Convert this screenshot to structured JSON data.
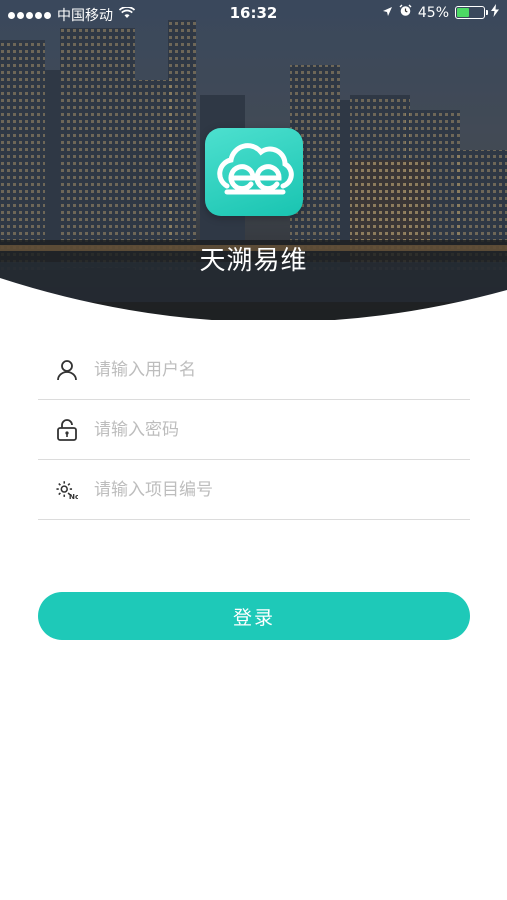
{
  "status_bar": {
    "carrier": "中国移动",
    "time": "16:32",
    "battery_percent": "45%",
    "battery_level": 0.45,
    "icons": [
      "signal-dots",
      "wifi-icon",
      "location-arrow-icon",
      "alarm-clock-icon",
      "battery-icon",
      "charging-bolt-icon"
    ]
  },
  "app": {
    "title": "天溯易维",
    "logo_icon": "ee-cloud-logo",
    "brand_color": "#1ec9b8"
  },
  "form": {
    "username": {
      "placeholder": "请输入用户名",
      "value": "",
      "icon": "user-icon"
    },
    "password": {
      "placeholder": "请输入密码",
      "value": "",
      "icon": "lock-icon"
    },
    "project_no": {
      "placeholder": "请输入项目编号",
      "value": "",
      "icon": "gear-no-icon"
    }
  },
  "login_button": {
    "label": "登录"
  }
}
